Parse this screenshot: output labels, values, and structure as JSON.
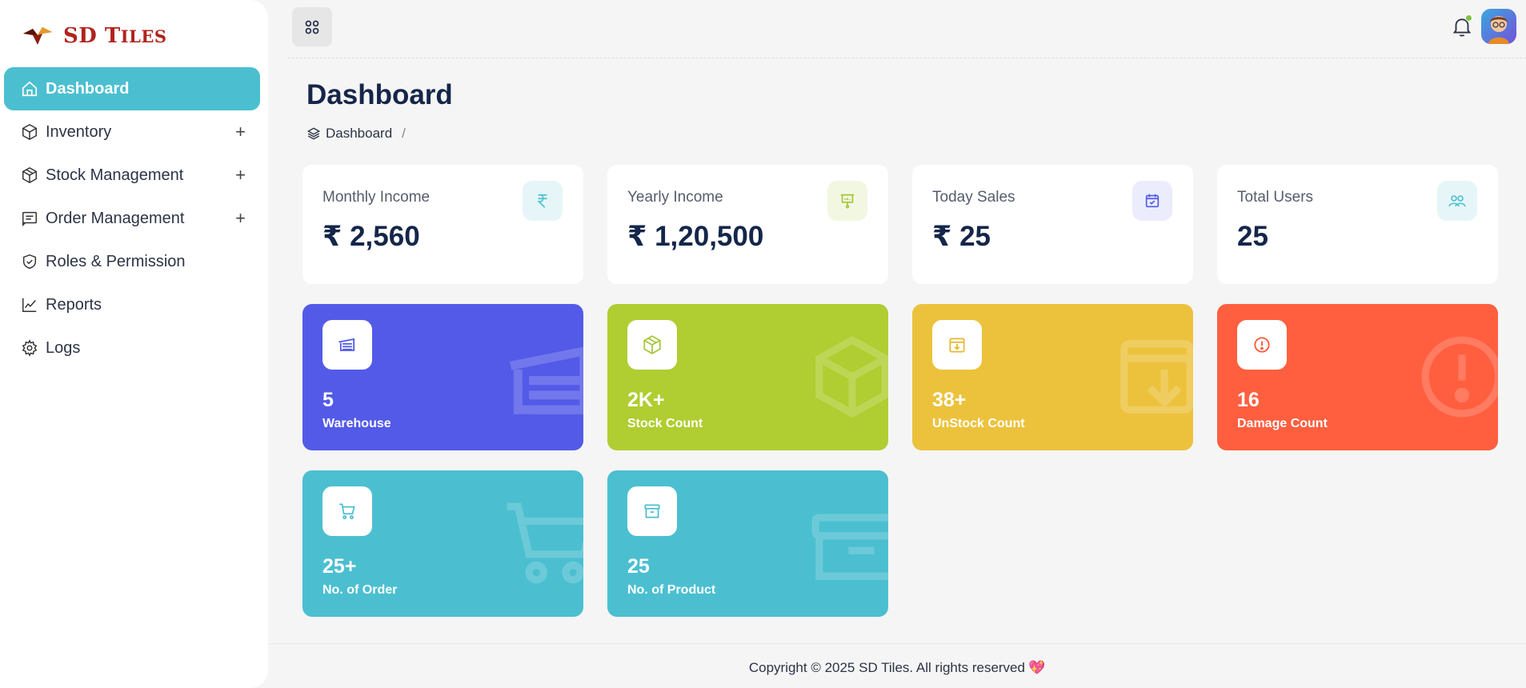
{
  "brand": {
    "name_first": "SD",
    "name_second_initial": "T",
    "name_second_rest": "ILES",
    "color": "#b1231d"
  },
  "sidebar": {
    "items": [
      {
        "label": "Dashboard",
        "icon": "home-icon",
        "active": true,
        "expandable": false
      },
      {
        "label": "Inventory",
        "icon": "cube-icon",
        "expandable": true
      },
      {
        "label": "Stock Management",
        "icon": "package-icon",
        "expandable": true
      },
      {
        "label": "Order Management",
        "icon": "receipt-icon",
        "expandable": true
      },
      {
        "label": "Roles & Permission",
        "icon": "shield-check-icon",
        "expandable": false
      },
      {
        "label": "Reports",
        "icon": "chart-line-icon",
        "expandable": false
      },
      {
        "label": "Logs",
        "icon": "gear-icon",
        "expandable": false
      }
    ],
    "expand_symbol": "+"
  },
  "header": {
    "menu_icon": "apps-grid-icon",
    "notification_icon": "bell-icon",
    "avatar_icon": "user-avatar"
  },
  "page": {
    "title": "Dashboard",
    "breadcrumb": {
      "item": "Dashboard",
      "separator": "/"
    }
  },
  "stats": [
    {
      "label": "Monthly Income",
      "value": "₹ 2,560",
      "icon": "rupee-icon",
      "icon_bg": "#e6f6f8",
      "icon_color": "#4bbfd0"
    },
    {
      "label": "Yearly Income",
      "value": "₹ 1,20,500",
      "icon": "presentation-icon",
      "icon_bg": "#f2f7e2",
      "icon_color": "#a4c639"
    },
    {
      "label": "Today Sales",
      "value": "₹ 25",
      "icon": "calendar-check-icon",
      "icon_bg": "#ebedfd",
      "icon_color": "#5059e6"
    },
    {
      "label": "Total Users",
      "value": "25",
      "icon": "users-icon",
      "icon_bg": "#e6f6f8",
      "icon_color": "#4bbfd0"
    }
  ],
  "cards": [
    {
      "value": "5",
      "label": "Warehouse",
      "icon": "warehouse-icon",
      "color": "#535ae8"
    },
    {
      "value": "2K+",
      "label": "Stock Count",
      "icon": "box-icon",
      "color": "#b0cd31"
    },
    {
      "value": "38+",
      "label": "UnStock Count",
      "icon": "archive-down-icon",
      "color": "#ecc23d"
    },
    {
      "value": "16",
      "label": "Damage Count",
      "icon": "alert-circle-icon",
      "color": "#ff5f3f"
    },
    {
      "value": "25+",
      "label": "No. of Order",
      "icon": "cart-icon",
      "color": "#4bbfd0"
    },
    {
      "value": "25",
      "label": "No. of Product",
      "icon": "archive-box-icon",
      "color": "#4bbfd0"
    }
  ],
  "footer": {
    "text": "Copyright © 2025 SD Tiles. All rights reserved",
    "heart": "💖"
  }
}
